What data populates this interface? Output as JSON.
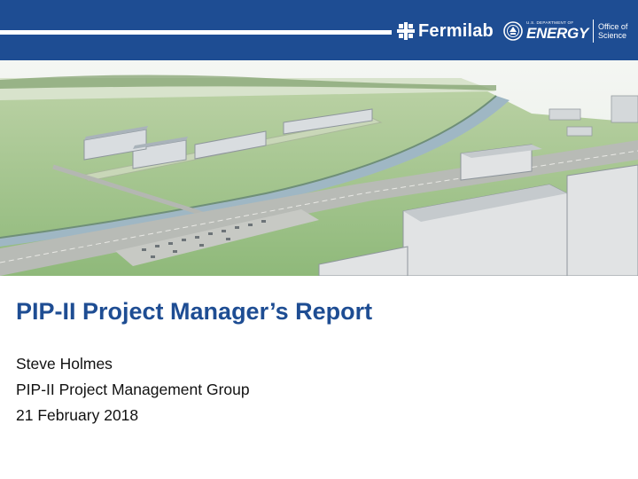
{
  "header": {
    "brand": "Fermilab",
    "doe_small": "U.S. DEPARTMENT OF",
    "doe_big": "ENERGY",
    "office_line1": "Office of",
    "office_line2": "Science",
    "bar_color": "#1e4d93"
  },
  "slide": {
    "title": "PIP-II Project Manager’s Report",
    "presenter": "Steve Holmes",
    "group": "PIP-II Project Management Group",
    "date": "21 February 2018"
  }
}
